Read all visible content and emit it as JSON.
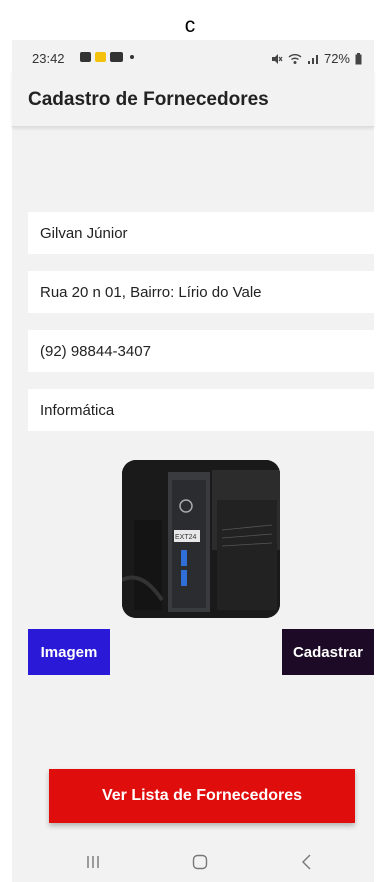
{
  "caption": "c",
  "status_bar": {
    "time": "23:42",
    "battery": "72%",
    "left_icons": [
      "gallery-icon",
      "notification-badge-icon",
      "youtube-icon",
      "dot-icon"
    ],
    "right_icons": [
      "mute-icon",
      "wifi-icon",
      "signal-icon",
      "battery-icon"
    ]
  },
  "app_bar": {
    "title": "Cadastro de Fornecedores"
  },
  "form": {
    "name": "Gilvan Júnior",
    "address": "Rua 20 n 01, Bairro: Lírio do Vale",
    "phone": "(92) 98844-3407",
    "category": "Informática"
  },
  "buttons": {
    "image": "Imagem",
    "register": "Cadastrar",
    "list": "Ver Lista de Fornecedores"
  },
  "photo": {
    "label_text": "EXT24"
  },
  "colors": {
    "image_button": "#2a1ad8",
    "register_button": "#1c0a26",
    "list_button": "#e00d0d",
    "background": "#f2f2f2"
  }
}
